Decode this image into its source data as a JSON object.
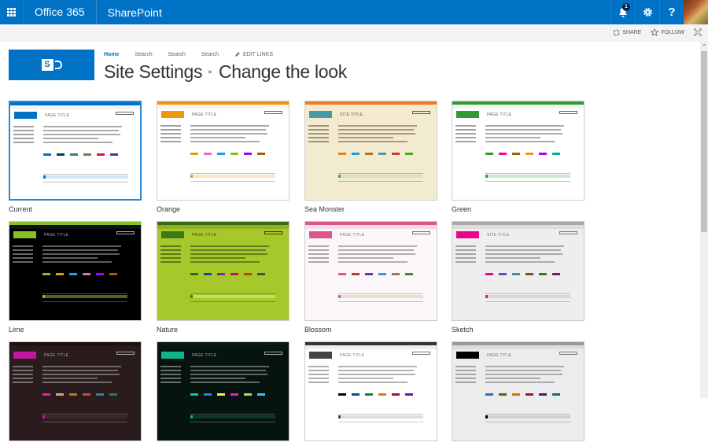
{
  "suitebar": {
    "brand": "Office 365",
    "app": "SharePoint",
    "notification_count": "1",
    "help_label": "?",
    "color": "#0072c6"
  },
  "actions": {
    "share": "SHARE",
    "follow": "FOLLOW"
  },
  "topnav": {
    "home": "Home",
    "links": [
      "Search",
      "Search",
      "Search"
    ],
    "edit_links": "EDIT LINKS"
  },
  "title": {
    "parent": "Site Settings",
    "current": "Change the look"
  },
  "themes": [
    {
      "name": "Current",
      "bar": "#0072c6",
      "sub": "#f4f4f4",
      "bg": "#ffffff",
      "logo": "#0072c6",
      "text": "#666666",
      "highlight": "#cde6f7",
      "swatches": [
        "#0072c6",
        "#003e4a",
        "#2e8b57",
        "#7a7a4a",
        "#e81123",
        "#5c2d91"
      ],
      "title_text": "PAGE TITLE",
      "selected": true
    },
    {
      "name": "Orange",
      "bar": "#f09609",
      "sub": "#f4f4f4",
      "bg": "#ffffff",
      "logo": "#f09609",
      "text": "#666666",
      "highlight": "#fde4c0",
      "swatches": [
        "#f09609",
        "#e36fbd",
        "#1ba1e2",
        "#8cbf26",
        "#a700ff",
        "#996600"
      ],
      "title_text": "PAGE TITLE",
      "selected": false
    },
    {
      "name": "Sea Monster",
      "bar": "#f47b20",
      "sub": "#f2ebcf",
      "bg": "#f2ebcf",
      "logo": "#4a9aa5",
      "text": "#6b5a3a",
      "highlight": "#e5dfb8",
      "swatches": [
        "#f47b20",
        "#1ba1e2",
        "#a08020",
        "#4a9aa5",
        "#d13438",
        "#3cb521"
      ],
      "title_text": "SITE TITLE",
      "selected": false
    },
    {
      "name": "Green",
      "bar": "#339933",
      "sub": "#f4f4f4",
      "bg": "#ffffff",
      "logo": "#339933",
      "text": "#666666",
      "highlight": "#c8eac8",
      "swatches": [
        "#339933",
        "#ff0097",
        "#996600",
        "#f09609",
        "#a700ff",
        "#00aba9"
      ],
      "title_text": "PAGE TITLE",
      "selected": false
    },
    {
      "name": "Lime",
      "bar": "#8cbf26",
      "sub": "#111111",
      "bg": "#000000",
      "logo": "#8cbf26",
      "text": "#aaaaaa",
      "highlight": "#4a6a1a",
      "swatches": [
        "#8cbf26",
        "#f09609",
        "#1ba1e2",
        "#e36fbd",
        "#a700ff",
        "#996600"
      ],
      "title_text": "PAGE TITLE",
      "selected": false
    },
    {
      "name": "Nature",
      "bar": "#3a6a10",
      "sub": "#8fb020",
      "bg": "#a6c82a",
      "logo": "#3a7a18",
      "text": "#2a4a10",
      "highlight": "#c4dc6a",
      "swatches": [
        "#2e6b1a",
        "#1c3f9e",
        "#7a2f9e",
        "#c0106a",
        "#c04010",
        "#4a4a5a"
      ],
      "title_text": "PAGE TITLE",
      "selected": false
    },
    {
      "name": "Blossom",
      "bar": "#d9578a",
      "sub": "#f7dbe6",
      "bg": "#fbf6f8",
      "logo": "#d9578a",
      "text": "#777777",
      "highlight": "#e6e0c8",
      "swatches": [
        "#d9578a",
        "#c0392b",
        "#5b3fa0",
        "#1ba1e2",
        "#a0784a",
        "#3c8c2c"
      ],
      "title_text": "PAGE TITLE",
      "selected": false
    },
    {
      "name": "Sketch",
      "bar": "#a8a8a8",
      "sub": "#dddddd",
      "bg": "#eeeeee",
      "logo": "#ec008c",
      "text": "#777777",
      "highlight": "#d6d6d6",
      "swatches": [
        "#ec008c",
        "#7a3fc8",
        "#4a8aa5",
        "#8a4a10",
        "#3a7a18",
        "#8a1a4a"
      ],
      "title_text": "SITE TITLE",
      "selected": false
    },
    {
      "name": "",
      "bar": "#1a1010",
      "sub": "#2a1a1a",
      "bg": "#2a1c1c",
      "logo": "#c0189a",
      "text": "#aaaaaa",
      "highlight": "#3a2a2a",
      "swatches": [
        "#e81fb0",
        "#c8a888",
        "#b8782a",
        "#c0503a",
        "#3a7aa5",
        "#2a7a5a"
      ],
      "title_text": "PAGE TITLE",
      "selected": false
    },
    {
      "name": "",
      "bar": "#0a1a14",
      "sub": "#0a1410",
      "bg": "#061410",
      "logo": "#13b38a",
      "text": "#aaaaaa",
      "highlight": "#0a3a2a",
      "swatches": [
        "#00d0a0",
        "#1a8ae2",
        "#f0f060",
        "#e81fc0",
        "#a0e060",
        "#40c0f0"
      ],
      "title_text": "PAGE TITLE",
      "selected": false
    },
    {
      "name": "",
      "bar": "#333333",
      "sub": "#eeeeee",
      "bg": "#ffffff",
      "logo": "#444444",
      "text": "#777777",
      "highlight": "#dddddd",
      "swatches": [
        "#000000",
        "#0050a0",
        "#1a7a4a",
        "#e07a00",
        "#a0103a",
        "#6a1aa0"
      ],
      "title_text": "PAGE TITLE",
      "selected": false
    },
    {
      "name": "",
      "bar": "#9a9a9a",
      "sub": "#dcdcdc",
      "bg": "#ececec",
      "logo": "#000000",
      "text": "#777777",
      "highlight": "#d0d0d0",
      "swatches": [
        "#2a70c0",
        "#4a6a10",
        "#d07010",
        "#a0104a",
        "#4a1a7a",
        "#1a6a5a"
      ],
      "title_text": "PAGE TITLE",
      "selected": false
    }
  ]
}
